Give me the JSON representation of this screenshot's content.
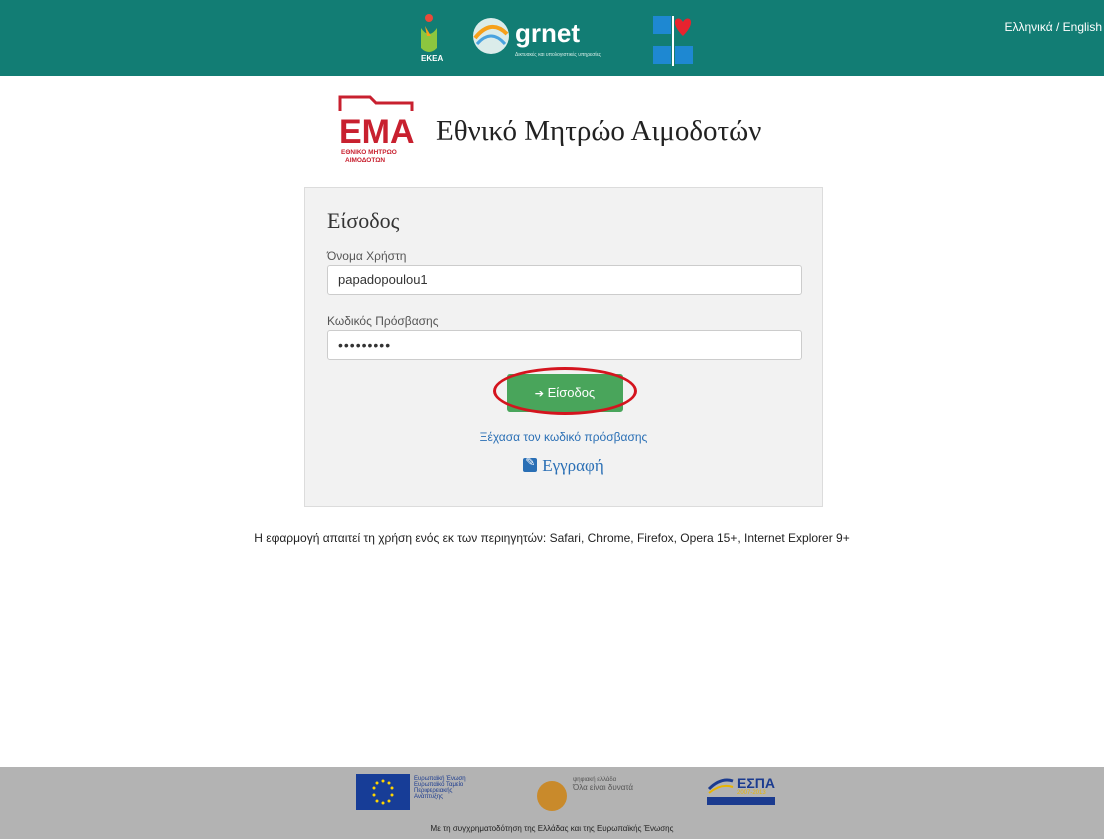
{
  "header": {
    "language_switch": "Ελληνικά / English",
    "partner_logos": {
      "ekea": "ΕΚΕΑ",
      "grnet": "grnet",
      "grnet_tagline": "Δικτυακές και υπολογιστικές υπηρεσίες"
    }
  },
  "brand": {
    "logo_text": "ΕΜΑ",
    "logo_subtitle_line1": "ΕΘΝΙΚΟ ΜΗΤΡΩΟ",
    "logo_subtitle_line2": "ΑΙΜΟΔΟΤΩΝ",
    "title": "Εθνικό Μητρώο Αιμοδοτών"
  },
  "login": {
    "heading": "Είσοδος",
    "username_label": "Όνομα Χρήστη",
    "username_value": "papadopoulou1",
    "password_label": "Κωδικός Πρόσβασης",
    "password_value": "•••••••••",
    "submit_icon": "sign-in-icon",
    "submit_label": "Είσοδος",
    "forgot_link": "Ξέχασα τον κωδικό πρόσβασης",
    "register_icon": "edit-icon",
    "register_link": "Εγγραφή"
  },
  "browser_notice": "Η εφαρμογή απαιτεί τη χρήση ενός εκ των περιηγητών: Safari, Chrome, Firefox, Opera 15+, Internet Explorer 9+",
  "footer": {
    "eu_text": "Ευρωπαϊκή Ένωση\nΕυρωπαϊκό Ταμείο\nΠεριφερειακής\nΑνάπτυξης",
    "digital_greece_line1": "ψηφιακή ελλάδα",
    "digital_greece_line2": "Όλα είναι δυνατά",
    "espa_text": "ΕΣΠΑ",
    "espa_years": "2007-2013",
    "caption": "Με τη συγχρηματοδότηση της Ελλάδας και της Ευρωπαϊκής Ένωσης"
  },
  "colors": {
    "header_bg": "#127d74",
    "button_green": "#49a55b",
    "link_blue": "#2a6fb5",
    "highlight_red": "#d4141e",
    "ema_red": "#c8202f"
  }
}
